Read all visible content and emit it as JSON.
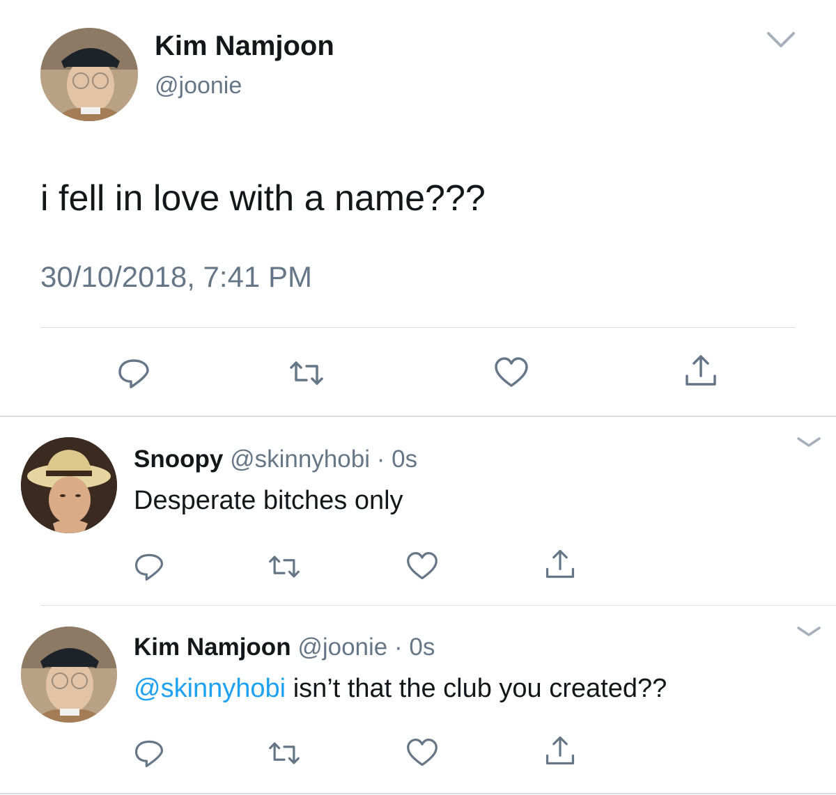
{
  "main_tweet": {
    "author_name": "Kim Namjoon",
    "handle": "@joonie",
    "text": "i fell in love with a name???",
    "timestamp": "30/10/2018, 7:41 PM"
  },
  "replies": [
    {
      "author_name": "Snoopy",
      "handle": "@skinnyhobi",
      "separator": "·",
      "time": "0s",
      "text": "Desperate bitches only"
    },
    {
      "author_name": "Kim Namjoon",
      "handle": "@joonie",
      "separator": "·",
      "time": "0s",
      "mention": "@skinnyhobi",
      "text": " isn’t that the club you created??"
    }
  ],
  "icons": [
    "reply-icon",
    "retweet-icon",
    "like-icon",
    "share-icon",
    "chevron-down-icon"
  ],
  "colors": {
    "text": "#14171a",
    "secondary": "#657786",
    "mention": "#1da1f2",
    "divider": "#d8dde2",
    "icon": "#657786"
  }
}
